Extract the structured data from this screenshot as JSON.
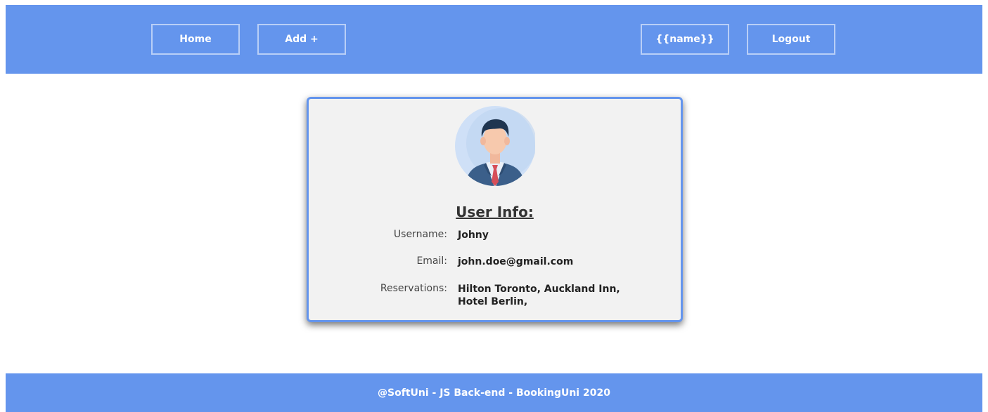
{
  "nav": {
    "home_label": "Home",
    "add_label": "Add +",
    "name_label": "{{name}}",
    "logout_label": "Logout"
  },
  "profile": {
    "title": "User Info:",
    "avatar_icon": "businessman-avatar-icon",
    "fields": [
      {
        "label": "Username:",
        "value": "Johny"
      },
      {
        "label": "Email:",
        "value": "john.doe@gmail.com"
      },
      {
        "label": "Reservations:",
        "value": "Hilton Toronto, Auckland Inn, Hotel Berlin,"
      }
    ]
  },
  "footer": {
    "text": "@SoftUni - JS Back-end - BookingUni 2020"
  },
  "colors": {
    "accent": "#6495ed",
    "card_bg": "#f2f2f2"
  }
}
